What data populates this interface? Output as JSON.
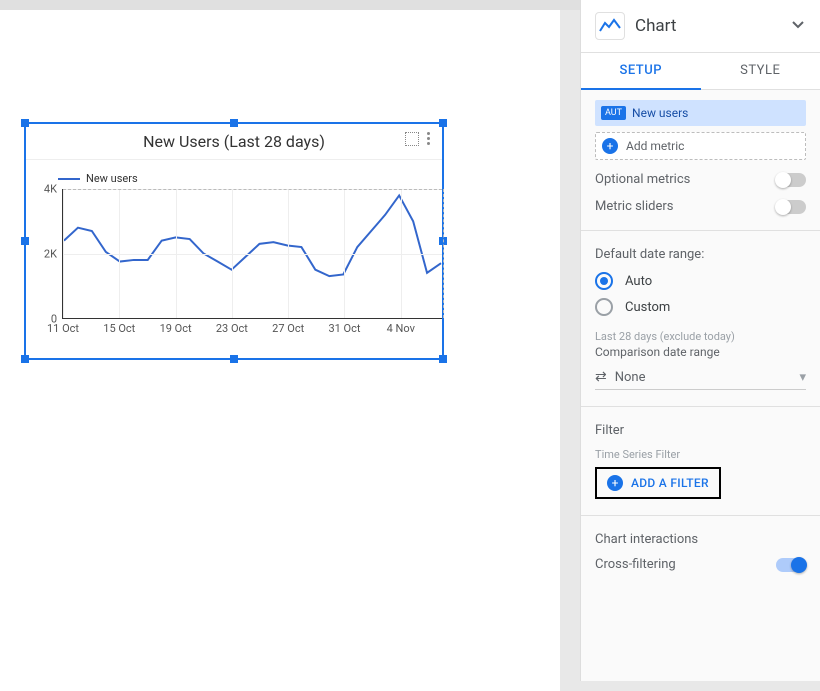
{
  "chart": {
    "title": "New Users (Last 28 days)",
    "legend": "New users"
  },
  "chart_data": {
    "type": "line",
    "title": "New Users (Last 28 days)",
    "xlabel": "",
    "ylabel": "",
    "ylim": [
      0,
      4000
    ],
    "yticks": [
      0,
      2000,
      4000
    ],
    "ytick_labels": [
      "0",
      "2K",
      "4K"
    ],
    "categories": [
      "11 Oct",
      "12 Oct",
      "13 Oct",
      "14 Oct",
      "15 Oct",
      "16 Oct",
      "17 Oct",
      "18 Oct",
      "19 Oct",
      "20 Oct",
      "21 Oct",
      "22 Oct",
      "23 Oct",
      "24 Oct",
      "25 Oct",
      "26 Oct",
      "27 Oct",
      "28 Oct",
      "29 Oct",
      "30 Oct",
      "31 Oct",
      "1 Nov",
      "2 Nov",
      "3 Nov",
      "4 Nov",
      "5 Nov",
      "6 Nov",
      "7 Nov"
    ],
    "xtick_labels": [
      "11 Oct",
      "15 Oct",
      "19 Oct",
      "23 Oct",
      "27 Oct",
      "31 Oct",
      "4 Nov"
    ],
    "series": [
      {
        "name": "New users",
        "values": [
          2400,
          2800,
          2700,
          2050,
          1750,
          1800,
          1800,
          2400,
          2500,
          2450,
          2000,
          1750,
          1500,
          1900,
          2300,
          2350,
          2250,
          2200,
          1500,
          1300,
          1350,
          2200,
          2700,
          3200,
          3800,
          3000,
          1400,
          1700
        ]
      }
    ]
  },
  "panel": {
    "header": "Chart",
    "tabs": {
      "setup": "SETUP",
      "style": "STYLE"
    },
    "metric_badge": "AUT",
    "metric_name": "New users",
    "add_metric": "Add metric",
    "optional_metrics": "Optional metrics",
    "metric_sliders": "Metric sliders",
    "date_range_title": "Default date range:",
    "auto": "Auto",
    "custom": "Custom",
    "last28": "Last 28 days (exclude today)",
    "comparison": "Comparison date range",
    "none": "None",
    "filter_title": "Filter",
    "filter_sub": "Time Series Filter",
    "add_filter": "ADD A FILTER",
    "interactions_title": "Chart interactions",
    "cross_filtering": "Cross-filtering"
  }
}
